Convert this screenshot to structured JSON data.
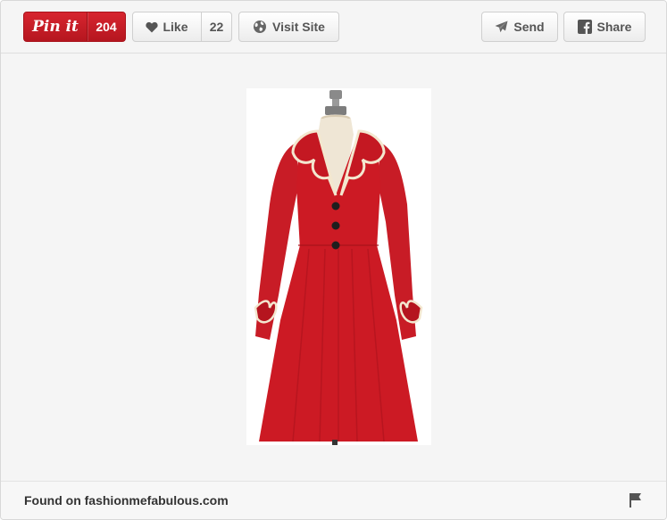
{
  "toolbar": {
    "pin_label": "Pin it",
    "pin_count": "204",
    "like_label": "Like",
    "like_count": "22",
    "visit_label": "Visit Site",
    "send_label": "Send",
    "share_label": "Share"
  },
  "footer": {
    "found_on": "Found on fashionmefabulous.com"
  },
  "image": {
    "subject": "red-coat-dress-on-mannequin"
  },
  "colors": {
    "pin_red": "#c8202a",
    "coat_red": "#cc1a24",
    "trim_cream": "#f3e7cf",
    "background": "#f5f5f5"
  },
  "icons": [
    "heart-icon",
    "globe-icon",
    "send-icon",
    "facebook-icon",
    "flag-icon"
  ]
}
